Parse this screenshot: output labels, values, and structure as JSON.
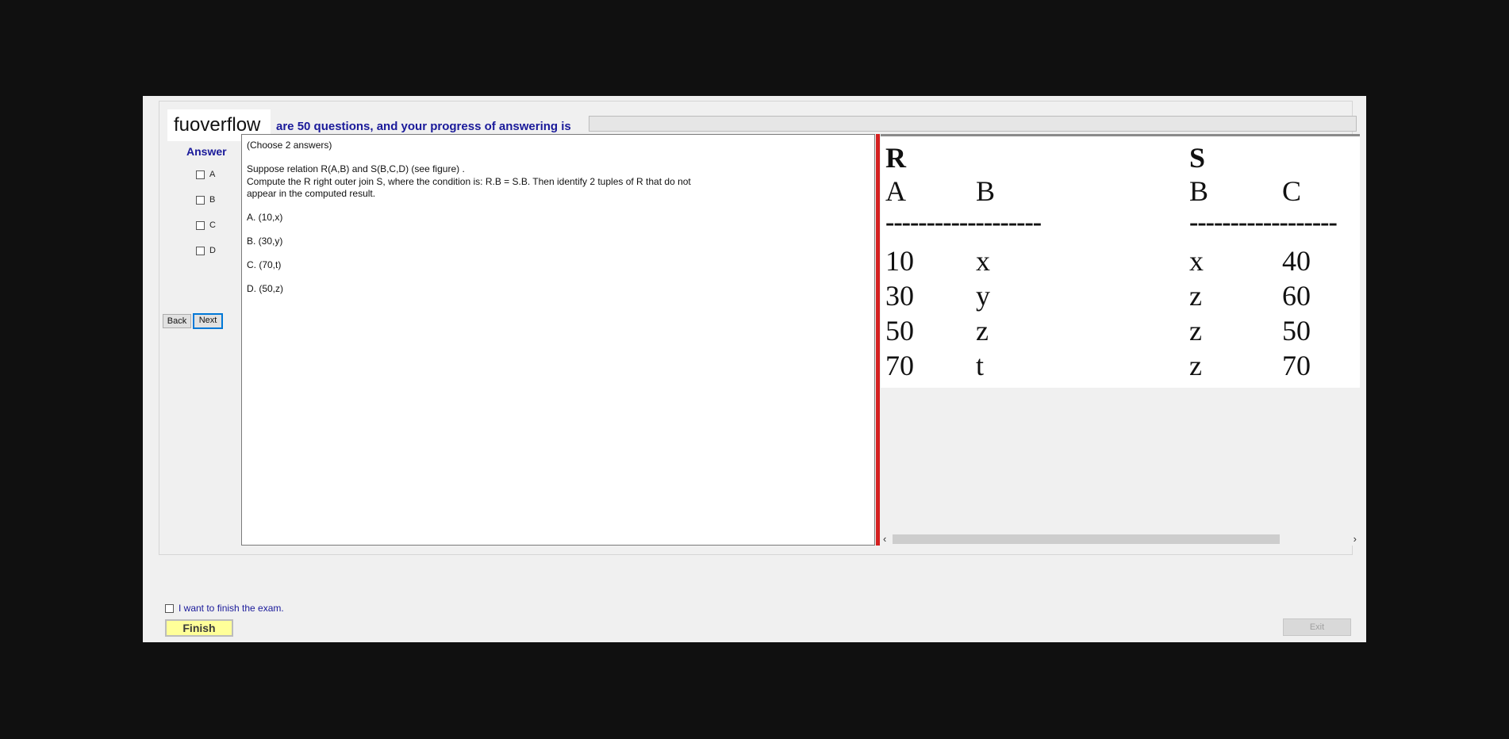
{
  "header": {
    "logo_text": "fuoverflow",
    "progress_text": "are 50 questions, and your progress of answering is",
    "progress_value": 0
  },
  "answer_panel": {
    "title": "Answer",
    "options": [
      {
        "label": "A",
        "checked": false
      },
      {
        "label": "B",
        "checked": false
      },
      {
        "label": "C",
        "checked": false
      },
      {
        "label": "D",
        "checked": false
      }
    ],
    "back_label": "Back",
    "next_label": "Next"
  },
  "question": {
    "instruction": "(Choose 2 answers)",
    "lines": [
      "Suppose relation R(A,B) and S(B,C,D)  (see figure) .",
      "Compute the R right outer join S, where the condition is: R.B = S.B. Then identify 2 tuples of R that do not",
      "appear in the computed result."
    ],
    "choices": [
      "A.  (10,x)",
      "B.  (30,y)",
      "C.  (70,t)",
      "D.  (50,z)"
    ]
  },
  "figure": {
    "r_title": "R",
    "s_title": "S",
    "r_headers": [
      "A",
      "B"
    ],
    "s_headers": [
      "B",
      "C"
    ],
    "r_divider": "-------------------",
    "s_divider": "------------------",
    "r_rows": [
      [
        "10",
        "x"
      ],
      [
        "30",
        "y"
      ],
      [
        "50",
        "z"
      ],
      [
        "70",
        "t"
      ]
    ],
    "s_rows": [
      [
        "x",
        "40"
      ],
      [
        "z",
        "60"
      ],
      [
        "z",
        "50"
      ],
      [
        "z",
        "70"
      ]
    ]
  },
  "footer": {
    "finish_check_label": "I want to finish the exam.",
    "finish_label": "Finish",
    "exit_label": "Exit"
  },
  "scrollbar": {
    "left_arrow": "‹",
    "right_arrow": "›"
  }
}
